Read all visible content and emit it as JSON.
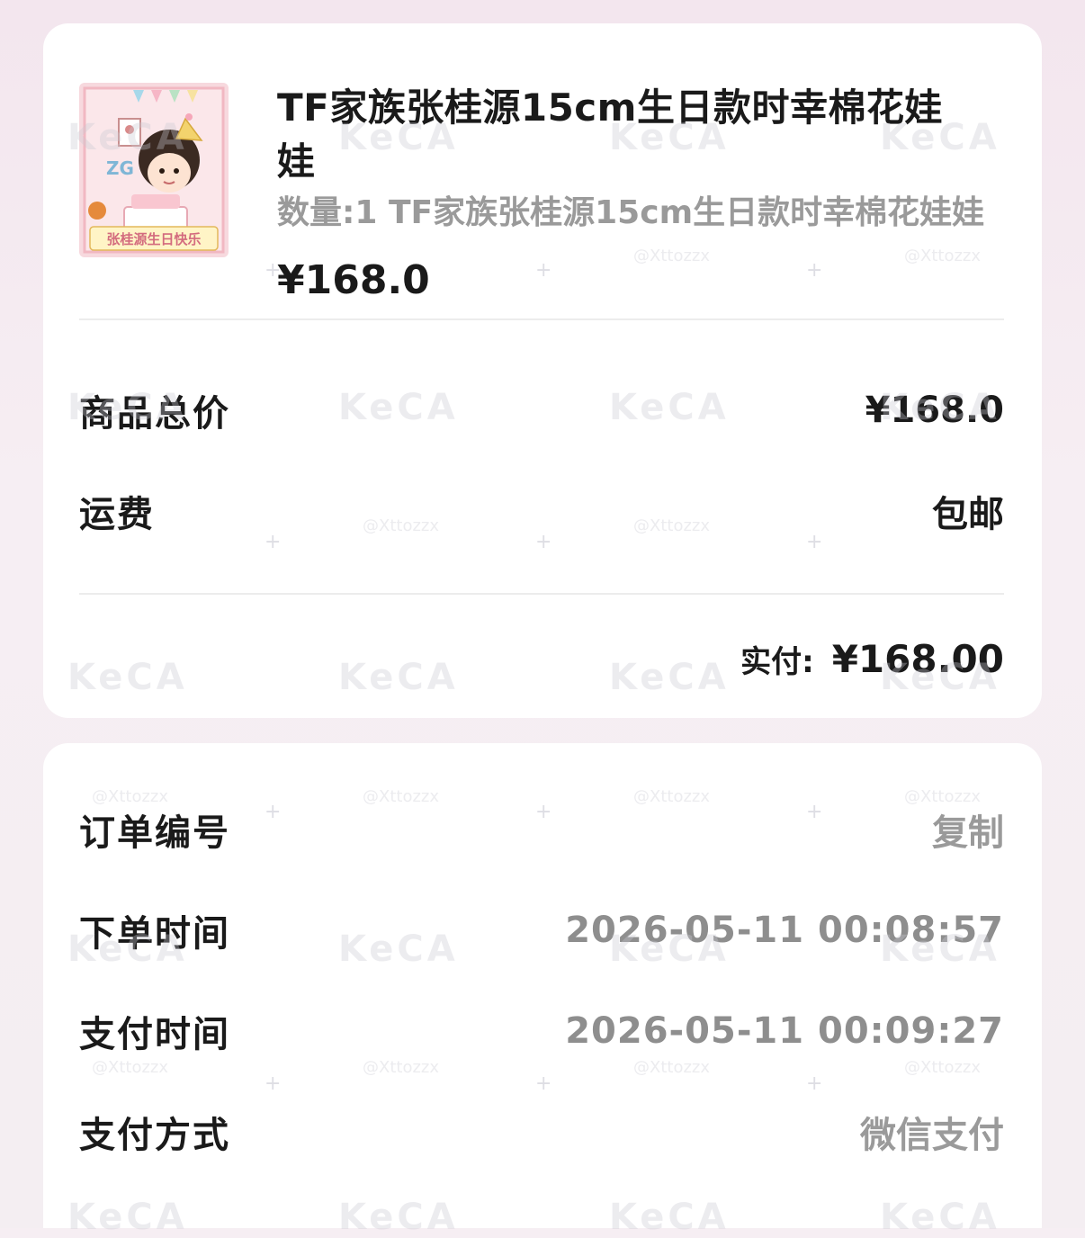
{
  "product": {
    "title": "TF家族张桂源15cm生日款时幸棉花娃娃",
    "variant": "数量:1 TF家族张桂源15cm生日款时幸棉花娃娃",
    "price": "¥168.0",
    "image_caption": "张桂源生日快乐"
  },
  "summary": {
    "goods_total_label": "商品总价",
    "goods_total_value": "¥168.0",
    "shipping_label": "运费",
    "shipping_value": "包邮",
    "paid_label": "实付:",
    "paid_value": "¥168.00"
  },
  "order_info": {
    "order_number_label": "订单编号",
    "copy_label": "复制",
    "order_time_label": "下单时间",
    "order_time_value": "2026-05-11 00:08:57",
    "pay_time_label": "支付时间",
    "pay_time_value": "2026-05-11 00:09:27",
    "pay_method_label": "支付方式",
    "pay_method_value": "微信支付"
  },
  "watermark": {
    "logo": "KeCA",
    "handle": "@Xttozzx"
  },
  "colors": {
    "background": "#f6eef3",
    "card": "#ffffff",
    "text": "#1a1a1a",
    "muted_text": "#9a9a9a"
  }
}
